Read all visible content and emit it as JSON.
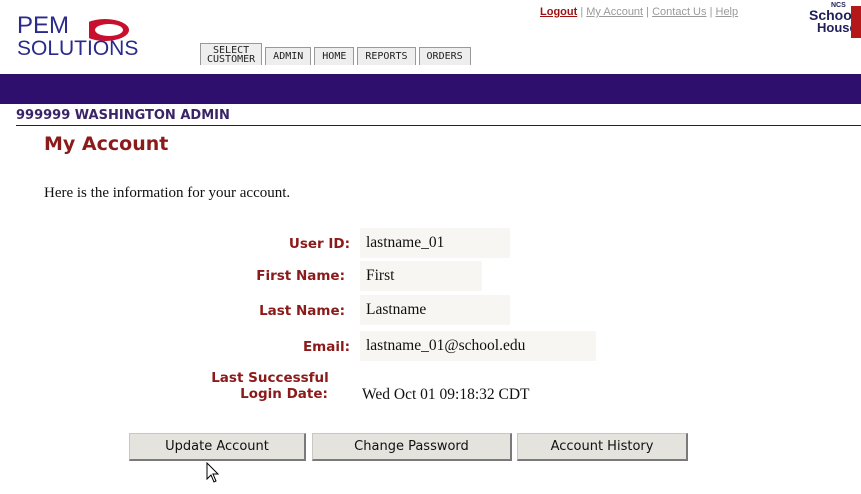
{
  "header": {
    "logo_line1": "PEM",
    "logo_line2": "SOLUTIONS",
    "links": {
      "logout": "Logout",
      "sep1": "|",
      "my_account": "My Account",
      "sep2": "|",
      "contact_us": "Contact Us",
      "sep3": "|",
      "help": "Help"
    },
    "ncs_logo": {
      "small": "NCS",
      "line1": "School",
      "line2": "House"
    },
    "tabs": [
      {
        "label_top": "SELECT",
        "label_bottom": "CUSTOMER"
      },
      {
        "label": "ADMIN"
      },
      {
        "label": "HOME"
      },
      {
        "label": "REPORTS"
      },
      {
        "label": "ORDERS"
      }
    ]
  },
  "org_line": "999999 WASHINGTON ADMIN",
  "page_title": "My Account",
  "intro": "Here is the information for your account.",
  "fields": {
    "user_id": {
      "label": "User ID:",
      "value": "lastname_01"
    },
    "first_name": {
      "label": "First Name:",
      "value": "First"
    },
    "last_name": {
      "label": "Last Name:",
      "value": "Lastname"
    },
    "email": {
      "label": "Email:",
      "value": "lastname_01@school.edu"
    },
    "last_login": {
      "label_line1": "Last Successful",
      "label_line2": "Login Date:",
      "value": "Wed Oct 01 09:18:32 CDT"
    }
  },
  "buttons": {
    "update": "Update Account",
    "change_password": "Change Password",
    "history": "Account History"
  },
  "colors": {
    "nav_bar": "#2e0f6e",
    "accent_red": "#8b1a1a",
    "logo_blue": "#2a2a8c",
    "logo_red": "#c8102e"
  }
}
